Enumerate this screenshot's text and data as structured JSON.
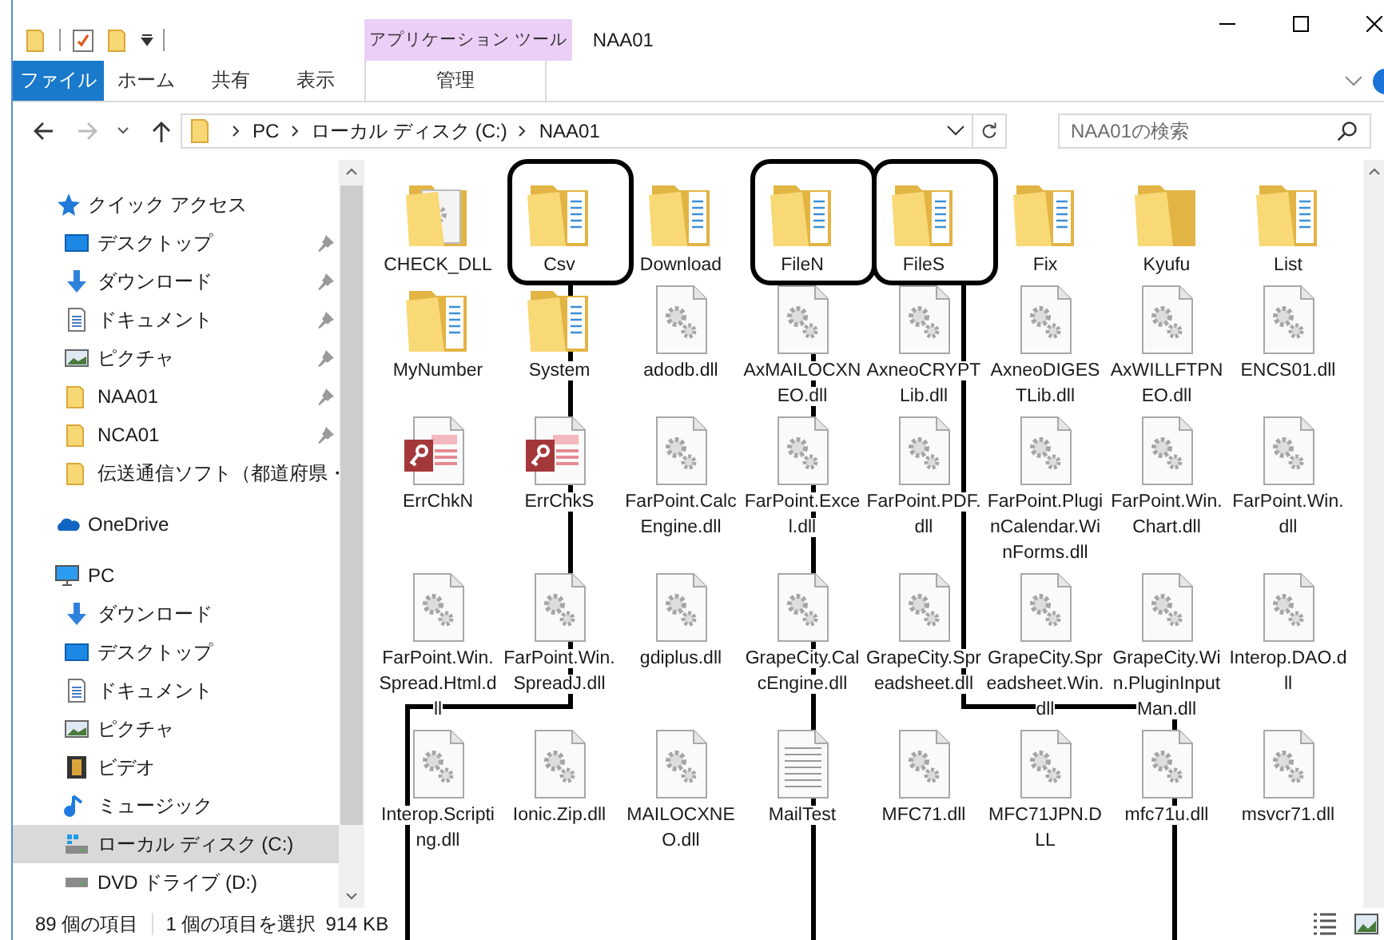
{
  "title_bar": {
    "context_group": "アプリケーション ツール",
    "title": "NAA01"
  },
  "ribbon_tabs": [
    {
      "label": "ファイル",
      "kind": "file",
      "selected": false
    },
    {
      "label": "ホーム",
      "kind": "tab",
      "selected": false
    },
    {
      "label": "共有",
      "kind": "tab",
      "selected": false
    },
    {
      "label": "表示",
      "kind": "tab",
      "selected": false
    },
    {
      "label": "管理",
      "kind": "context",
      "selected": false
    }
  ],
  "navigation": {
    "back_enabled": true,
    "forward_enabled": false
  },
  "address": {
    "crumbs": [
      "PC",
      "ローカル ディスク (C:)",
      "NAA01"
    ]
  },
  "search": {
    "placeholder": "NAA01の検索"
  },
  "sidebar": [
    {
      "label": "クイック アクセス",
      "kind": "star",
      "selected": false,
      "children": [
        {
          "label": "デスクトップ",
          "kind": "desktop",
          "pinned": true,
          "selected": false
        },
        {
          "label": "ダウンロード",
          "kind": "download",
          "pinned": true,
          "selected": false
        },
        {
          "label": "ドキュメント",
          "kind": "document",
          "pinned": true,
          "selected": false
        },
        {
          "label": "ピクチャ",
          "kind": "picture",
          "pinned": true,
          "selected": false
        },
        {
          "label": "NAA01",
          "kind": "folder",
          "pinned": true,
          "selected": false
        },
        {
          "label": "NCA01",
          "kind": "folder",
          "pinned": true,
          "selected": false
        },
        {
          "label": "伝送通信ソフト（都道府県・",
          "kind": "folder",
          "pinned": false,
          "selected": false
        }
      ]
    },
    {
      "label": "OneDrive",
      "kind": "cloud",
      "selected": false
    },
    {
      "label": "PC",
      "kind": "pc",
      "selected": false,
      "children": [
        {
          "label": "ダウンロード",
          "kind": "download",
          "selected": false
        },
        {
          "label": "デスクトップ",
          "kind": "desktop",
          "selected": false
        },
        {
          "label": "ドキュメント",
          "kind": "document",
          "selected": false
        },
        {
          "label": "ピクチャ",
          "kind": "picture",
          "selected": false
        },
        {
          "label": "ビデオ",
          "kind": "video",
          "selected": false
        },
        {
          "label": "ミュージック",
          "kind": "music",
          "selected": false
        },
        {
          "label": "ローカル ディスク (C:)",
          "kind": "drive",
          "selected": true
        },
        {
          "label": "DVD ドライブ (D:)",
          "kind": "dvd",
          "selected": false
        }
      ]
    }
  ],
  "items": [
    {
      "name": "CHECK_DLL",
      "kind": "folder-gear",
      "highlighted": false
    },
    {
      "name": "Csv",
      "kind": "folder",
      "highlighted": true
    },
    {
      "name": "Download",
      "kind": "folder",
      "highlighted": false
    },
    {
      "name": "FileN",
      "kind": "folder",
      "highlighted": true
    },
    {
      "name": "FileS",
      "kind": "folder",
      "highlighted": true
    },
    {
      "name": "Fix",
      "kind": "folder",
      "highlighted": false
    },
    {
      "name": "Kyufu",
      "kind": "folder-empty",
      "highlighted": false
    },
    {
      "name": "List",
      "kind": "folder",
      "highlighted": false
    },
    {
      "name": "MyNumber",
      "kind": "folder",
      "highlighted": false
    },
    {
      "name": "System",
      "kind": "folder",
      "highlighted": false
    },
    {
      "name": "adodb.dll",
      "kind": "dll",
      "highlighted": false
    },
    {
      "name": "AxMAILOCXNEO.dll",
      "kind": "dll",
      "highlighted": false
    },
    {
      "name": "AxneoCRYPTLib.dll",
      "kind": "dll",
      "highlighted": false
    },
    {
      "name": "AxneoDIGESTLib.dll",
      "kind": "dll",
      "highlighted": false
    },
    {
      "name": "AxWILLFTPNEO.dll",
      "kind": "dll",
      "highlighted": false
    },
    {
      "name": "ENCS01.dll",
      "kind": "dll",
      "highlighted": false
    },
    {
      "name": "ErrChkN",
      "kind": "access",
      "highlighted": false
    },
    {
      "name": "ErrChkS",
      "kind": "access",
      "highlighted": false
    },
    {
      "name": "FarPoint.CalcEngine.dll",
      "kind": "dll",
      "highlighted": false
    },
    {
      "name": "FarPoint.Excel.dll",
      "kind": "dll",
      "highlighted": false
    },
    {
      "name": "FarPoint.PDF.dll",
      "kind": "dll",
      "highlighted": false
    },
    {
      "name": "FarPoint.PluginCalendar.WinForms.dll",
      "kind": "dll",
      "highlighted": false
    },
    {
      "name": "FarPoint.Win.Chart.dll",
      "kind": "dll",
      "highlighted": false
    },
    {
      "name": "FarPoint.Win.dll",
      "kind": "dll",
      "highlighted": false
    },
    {
      "name": "FarPoint.Win.Spread.Html.dll",
      "kind": "dll",
      "highlighted": false
    },
    {
      "name": "FarPoint.Win.SpreadJ.dll",
      "kind": "dll",
      "highlighted": false
    },
    {
      "name": "gdiplus.dll",
      "kind": "dll",
      "highlighted": false
    },
    {
      "name": "GrapeCity.CalcEngine.dll",
      "kind": "dll",
      "highlighted": false
    },
    {
      "name": "GrapeCity.Spreadsheet.dll",
      "kind": "dll",
      "highlighted": false
    },
    {
      "name": "GrapeCity.Spreadsheet.Win.dll",
      "kind": "dll",
      "highlighted": false
    },
    {
      "name": "GrapeCity.Win.PluginInputMan.dll",
      "kind": "dll",
      "highlighted": false
    },
    {
      "name": "Interop.DAO.dll",
      "kind": "dll",
      "highlighted": false
    },
    {
      "name": "Interop.Scripting.dll",
      "kind": "dll",
      "highlighted": false
    },
    {
      "name": "Ionic.Zip.dll",
      "kind": "dll",
      "highlighted": false
    },
    {
      "name": "MAILOCXNEO.dll",
      "kind": "dll",
      "highlighted": false
    },
    {
      "name": "MailTest",
      "kind": "text",
      "highlighted": false
    },
    {
      "name": "MFC71.dll",
      "kind": "dll",
      "highlighted": false
    },
    {
      "name": "MFC71JPN.DLL",
      "kind": "dll",
      "highlighted": false
    },
    {
      "name": "mfc71u.dll",
      "kind": "dll",
      "highlighted": false
    },
    {
      "name": "msvcr71.dll",
      "kind": "dll",
      "highlighted": false
    }
  ],
  "status_bar": {
    "count": "89 個の項目",
    "selection": "1 個の項目を選択",
    "size": "914 KB"
  }
}
